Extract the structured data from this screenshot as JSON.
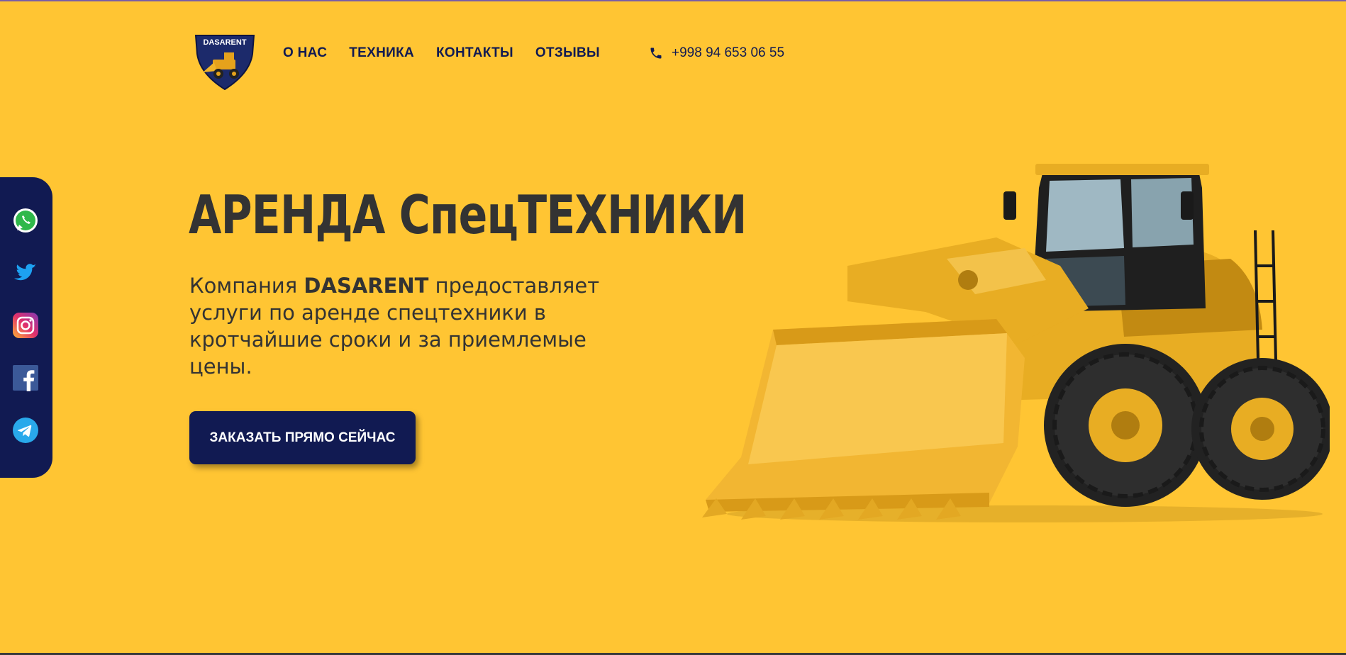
{
  "brand": {
    "name": "DASARENT"
  },
  "nav": {
    "items": [
      {
        "label": "О НАС"
      },
      {
        "label": "ТЕХНИКА"
      },
      {
        "label": "КОНТАКТЫ"
      },
      {
        "label": "ОТЗЫВЫ"
      }
    ],
    "phone": "+998 94 653 06 55"
  },
  "hero": {
    "title": "АРЕНДА СпецТЕХНИКИ",
    "text_before": "Компания ",
    "text_brand": "DASARENT",
    "text_after": " предоставляет услуги по аренде спецтехники в кротчайшие сроки и за приемлемые цены.",
    "cta_label": "ЗАКАЗАТЬ ПРЯМО СЕЙЧАС"
  },
  "social": {
    "icons": [
      "whatsapp-icon",
      "twitter-icon",
      "instagram-icon",
      "facebook-icon",
      "telegram-icon"
    ]
  },
  "colors": {
    "background": "#FFC533",
    "navy": "#111A52",
    "text": "#333333"
  }
}
